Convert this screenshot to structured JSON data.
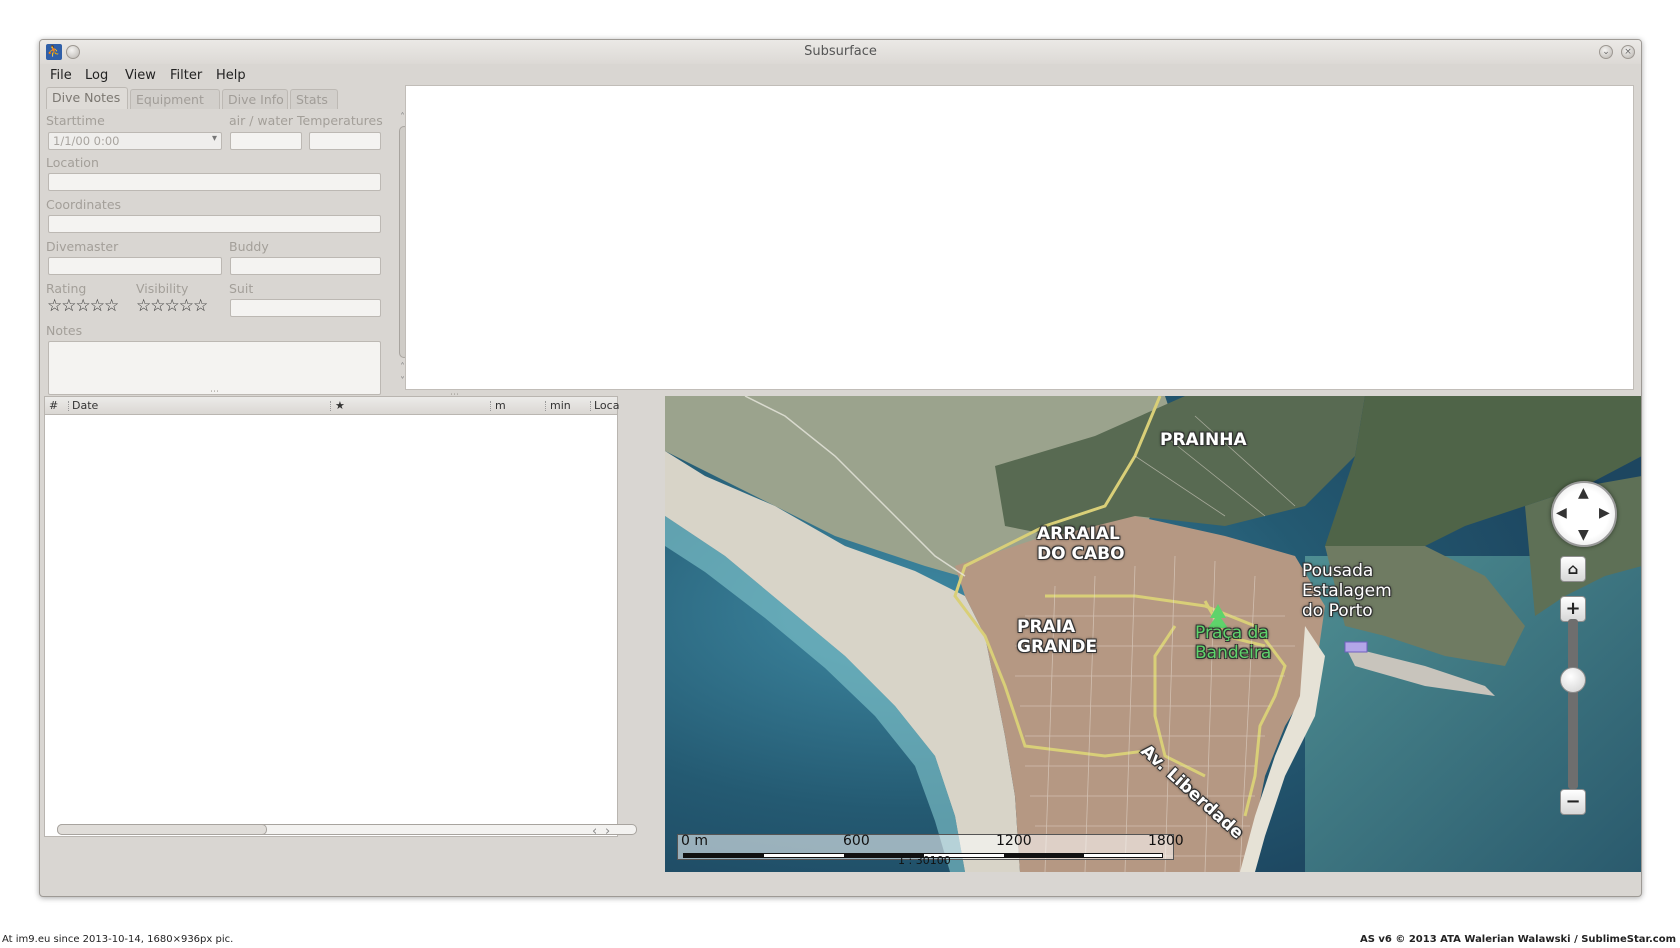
{
  "window": {
    "title": "Subsurface"
  },
  "menu": [
    "File",
    "Log",
    "View",
    "Filter",
    "Help"
  ],
  "tabs": [
    "Dive Notes",
    "Equipment",
    "Dive Info",
    "Stats"
  ],
  "notes": {
    "starttime_label": "Starttime",
    "starttime_value": "1/1/00 0:00",
    "temps_label": "air / water Temperatures",
    "location_label": "Location",
    "coordinates_label": "Coordinates",
    "divemaster_label": "Divemaster",
    "buddy_label": "Buddy",
    "rating_label": "Rating",
    "visibility_label": "Visibility",
    "suit_label": "Suit",
    "notes_label": "Notes",
    "rating_stars": "☆☆☆☆☆",
    "visibility_stars": "☆☆☆☆☆"
  },
  "dive_list": {
    "columns": [
      "#",
      "Date",
      "★",
      "m",
      "min",
      "Loca"
    ]
  },
  "map": {
    "labels": {
      "prainha": "PRAINHA",
      "arraial": "ARRAIAL\nDO CABO",
      "praia_grande": "PRAIA\nGRANDE",
      "praca": "Praça da\nBandeira",
      "pousada": "Pousada\nEstalagem\ndo Porto",
      "liberdade": "Av. Liberdade"
    },
    "scale": {
      "ticks": [
        "0 m",
        "600",
        "1200",
        "1800"
      ],
      "ratio": "1 : 30100"
    },
    "controls": {
      "home_icon": "⌂",
      "zoom_in": "+",
      "zoom_out": "−"
    }
  },
  "footer": {
    "left": "At im9.eu  since 2013-10-14, 1680×936px pic.",
    "right": "AS v6 © 2013 ATA Walerian Walawski / SublimeStar.com"
  }
}
